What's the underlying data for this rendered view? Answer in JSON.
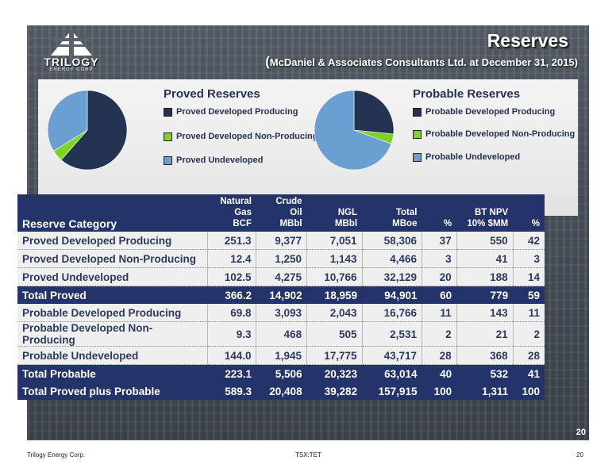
{
  "header": {
    "logo_text": "TRILOGY",
    "logo_subtext": "ENERGY CORP",
    "title": "Reserves",
    "subtitle_paren_open": "(",
    "subtitle": "McDaniel & Associates Consultants Ltd. at December 31, 2015)"
  },
  "colors": {
    "producing": "#243352",
    "non_producing": "#7ed321",
    "undeveloped": "#6a9fd1",
    "table_header": "#243369"
  },
  "proved_legend": {
    "title": "Proved Reserves",
    "items": [
      "Proved Developed Producing",
      "Proved Developed Non-Producing",
      "Proved Undeveloped"
    ]
  },
  "probable_legend": {
    "title": "Probable Reserves",
    "items": [
      "Probable Developed Producing",
      "Probable Developed Non-Producing",
      "Probable Undeveloped"
    ]
  },
  "chart_data": [
    {
      "type": "pie",
      "categories": [
        "Proved Developed Producing",
        "Proved Developed Non-Producing",
        "Proved Undeveloped"
      ],
      "values": [
        58306,
        4466,
        32129
      ]
    },
    {
      "type": "pie",
      "categories": [
        "Probable Developed Producing",
        "Probable Developed Non-Producing",
        "Probable Undeveloped"
      ],
      "values": [
        16766,
        2531,
        43717
      ]
    }
  ],
  "table": {
    "header_rows": [
      [
        "",
        "Natural",
        "Crude",
        "",
        "",
        "",
        "",
        ""
      ],
      [
        "",
        "Gas",
        "Oil",
        "NGL",
        "Total",
        "",
        "BT NPV",
        ""
      ],
      [
        "Reserve Category",
        "BCF",
        "MBbl",
        "MBbl",
        "MBoe",
        "%",
        "10% $MM",
        "%"
      ]
    ],
    "rows": [
      {
        "style": "light",
        "cells": [
          "Proved Developed Producing",
          "251.3",
          "9,377",
          "7,051",
          "58,306",
          "37",
          "550",
          "42"
        ]
      },
      {
        "style": "light",
        "cells": [
          "Proved Developed Non-Producing",
          "12.4",
          "1,250",
          "1,143",
          "4,466",
          "3",
          "41",
          "3"
        ]
      },
      {
        "style": "light",
        "cells": [
          "Proved Undeveloped",
          "102.5",
          "4,275",
          "10,766",
          "32,129",
          "20",
          "188",
          "14"
        ]
      },
      {
        "style": "dark",
        "cells": [
          "Total Proved",
          "366.2",
          "14,902",
          "18,959",
          "94,901",
          "60",
          "779",
          "59"
        ]
      },
      {
        "style": "light",
        "cells": [
          "Probable Developed Producing",
          "69.8",
          "3,093",
          "2,043",
          "16,766",
          "11",
          "143",
          "11"
        ]
      },
      {
        "style": "light",
        "cells": [
          "Probable Developed Non-Producing",
          "9.3",
          "468",
          "505",
          "2,531",
          "2",
          "21",
          "2"
        ]
      },
      {
        "style": "light",
        "cells": [
          "Probable Undeveloped",
          "144.0",
          "1,945",
          "17,775",
          "43,717",
          "28",
          "368",
          "28"
        ]
      },
      {
        "style": "dark",
        "cells": [
          "Total Probable",
          "223.1",
          "5,506",
          "20,323",
          "63,014",
          "40",
          "532",
          "41"
        ]
      },
      {
        "style": "dark",
        "cells": [
          "Total Proved plus Probable",
          "589.3",
          "20,408",
          "39,282",
          "157,915",
          "100",
          "1,311",
          "100"
        ]
      }
    ]
  },
  "slide_page_number": "20",
  "footer": {
    "left": "Trilogy Energy Corp.",
    "center": "TSX:TET",
    "right": "20"
  }
}
